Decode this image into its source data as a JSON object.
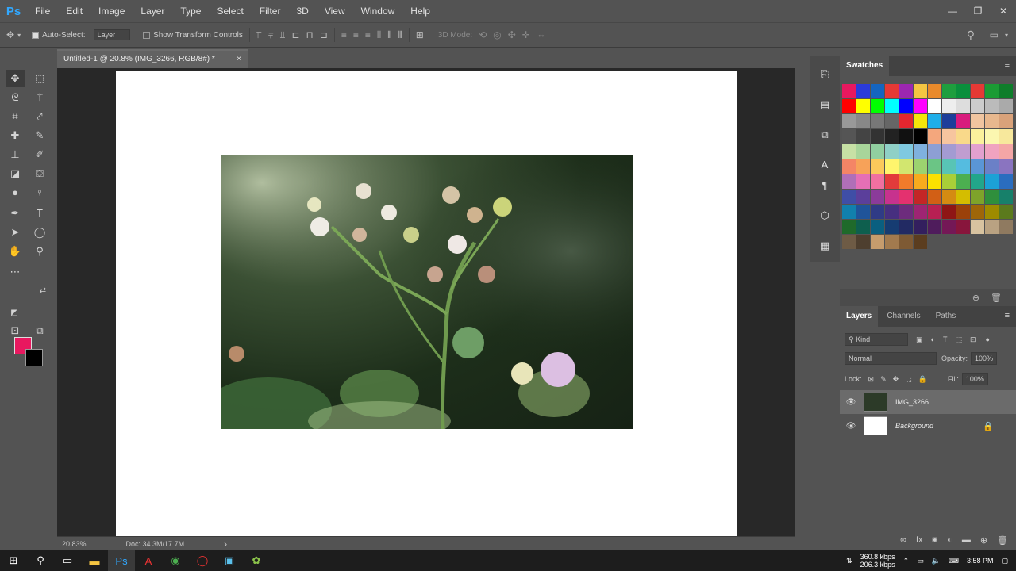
{
  "app": {
    "logo": "Ps"
  },
  "menu": [
    "File",
    "Edit",
    "Image",
    "Layer",
    "Type",
    "Select",
    "Filter",
    "3D",
    "View",
    "Window",
    "Help"
  ],
  "window_controls": {
    "minimize": "—",
    "restore": "❐",
    "close": "✕"
  },
  "options_bar": {
    "auto_select_label": "Auto-Select:",
    "auto_select_target": "Layer",
    "show_transform_label": "Show Transform Controls",
    "mode_3d_label": "3D Mode:"
  },
  "document": {
    "tab_title": "Untitled-1 @ 20.8% (IMG_3266, RGB/8#) *",
    "close_glyph": "×"
  },
  "status": {
    "zoom": "20.83%",
    "doc_size": "Doc: 34.3M/17.7M",
    "arrow": "›"
  },
  "colors": {
    "foreground": "#e8185f",
    "background": "#000000"
  },
  "swatches_panel": {
    "tab": "Swatches"
  },
  "swatch_colors": [
    "#e8185f",
    "#2b3bd9",
    "#1565c0",
    "#e53935",
    "#9c27b0",
    "#f5c542",
    "#e98a2b",
    "#1e9e3e",
    "#0a8f3c",
    "#e53935",
    "#1b9b34",
    "#0e7d2a",
    "#ff0000",
    "#ffff00",
    "#00ff00",
    "#00ffff",
    "#0000ff",
    "#ff00ff",
    "#ffffff",
    "#eeeeee",
    "#dddddd",
    "#cccccc",
    "#bbbbbb",
    "#aaaaaa",
    "#999999",
    "#888888",
    "#777777",
    "#666666",
    "#e3262f",
    "#f5e50a",
    "#1faee9",
    "#1d3e9a",
    "#d81b7d",
    "#f0c5a0",
    "#e8b88e",
    "#d9a27a",
    "#555555",
    "#444444",
    "#333333",
    "#222222",
    "#111111",
    "#000000",
    "#f4a77d",
    "#f7c59f",
    "#f9d98a",
    "#fbf19c",
    "#fbf7b0",
    "#f7e89c",
    "#c7e1a5",
    "#a8d59a",
    "#91cfa0",
    "#8fd0c6",
    "#7fc9e0",
    "#7fb1de",
    "#8d9fd4",
    "#a39bd2",
    "#c09dd0",
    "#e3a0cf",
    "#f0a3c0",
    "#f4a6a6",
    "#f48566",
    "#f7a259",
    "#fbc95b",
    "#fff56d",
    "#d2e66f",
    "#9cd36f",
    "#6bc585",
    "#58c4b5",
    "#55bce0",
    "#5a96d6",
    "#6b80c7",
    "#8a74c0",
    "#b06fb8",
    "#e56fb6",
    "#f070a0",
    "#e33b3b",
    "#f27b2b",
    "#f7ab1e",
    "#fbe100",
    "#a9cf38",
    "#4caf50",
    "#22a68a",
    "#1ca1d6",
    "#2a6dbf",
    "#3f4ea6",
    "#5b3f9b",
    "#8b3b9a",
    "#c7328e",
    "#e4316f",
    "#c42626",
    "#d25f15",
    "#d48b12",
    "#d4bd00",
    "#7ea32a",
    "#2f8f3c",
    "#17806a",
    "#1180ad",
    "#1f549a",
    "#2f3b86",
    "#472f80",
    "#6d2c7d",
    "#9e2473",
    "#b82053",
    "#8e1515",
    "#9b410a",
    "#9e6609",
    "#9e8b00",
    "#5b7a1d",
    "#1f6a2a",
    "#0e5f4e",
    "#0a5f80",
    "#163c72",
    "#222a63",
    "#331f5e",
    "#4f1c5c",
    "#741856",
    "#88153c",
    "#d8c3a0",
    "#b9a282",
    "#8f7a60",
    "#6e5b45",
    "#4e3f2f",
    "#c69c6d",
    "#a27a4e",
    "#7e5a34",
    "#5b3d1f"
  ],
  "layers_panel": {
    "tabs": [
      "Layers",
      "Channels",
      "Paths"
    ],
    "kind_label": "Kind",
    "blend_mode": "Normal",
    "opacity_label": "Opacity:",
    "opacity_value": "100%",
    "lock_label": "Lock:",
    "fill_label": "Fill:",
    "fill_value": "100%",
    "layers": [
      {
        "name": "IMG_3266"
      },
      {
        "name": "Background"
      }
    ]
  },
  "taskbar": {
    "net_up": "360.8 kbps",
    "net_down": "206.3 kbps",
    "time": "3:58 PM"
  }
}
